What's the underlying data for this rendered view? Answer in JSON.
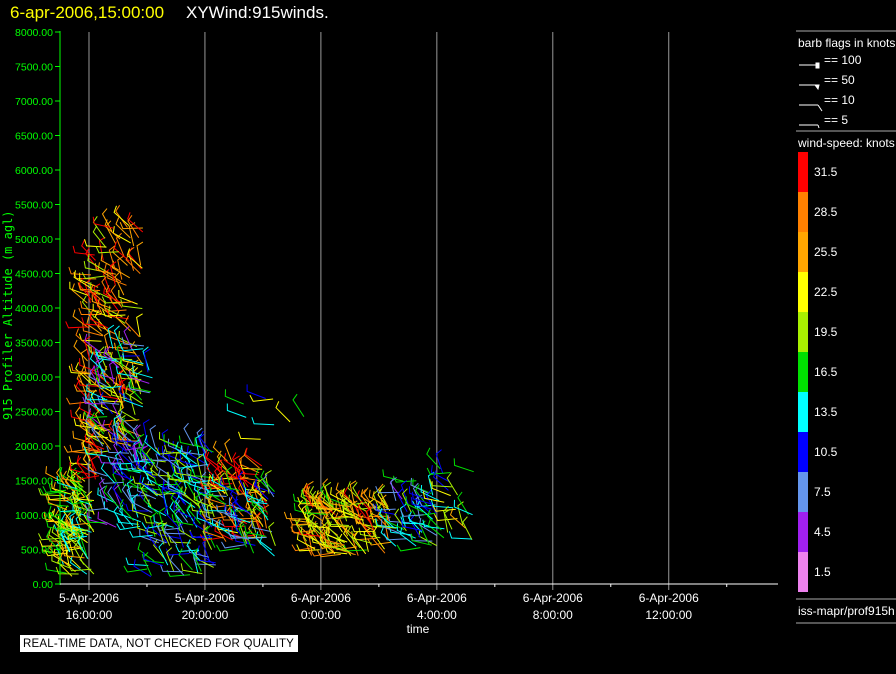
{
  "header": {
    "datetime": "6-apr-2006,15:00:00",
    "title": "XYWind:915winds."
  },
  "notice": "REAL-TIME DATA, NOT CHECKED FOR QUALITY",
  "legend": {
    "barb_title": "barb flags in knots",
    "barb_items": [
      "== 100",
      "== 50",
      "== 10",
      "== 5"
    ],
    "speed_title": "wind-speed: knots",
    "speed_labels": [
      "31.5",
      "28.5",
      "25.5",
      "22.5",
      "19.5",
      "16.5",
      "13.5",
      "10.5",
      "7.5",
      "4.5",
      "1.5"
    ],
    "speed_colors": [
      "#ff0000",
      "#ff8000",
      "#ffa500",
      "#ffff00",
      "#a8f000",
      "#00e000",
      "#00ffff",
      "#0000ff",
      "#6495ed",
      "#a020f0",
      "#ee82ee"
    ],
    "source": "iss-mapr/prof915h"
  },
  "chart_data": {
    "type": "scatter",
    "subtype": "wind-barb",
    "title": "XYWind:915winds.",
    "xlabel": "time",
    "ylabel": "915 Profiler Altitude (m agl)",
    "ylim": [
      0,
      8000
    ],
    "yticks": [
      "0.00",
      "500.00",
      "1000.00",
      "1500.00",
      "2000.00",
      "2500.00",
      "3000.00",
      "3500.00",
      "4000.00",
      "4500.00",
      "5000.00",
      "5500.00",
      "6000.00",
      "6500.00",
      "7000.00",
      "7500.00",
      "8000.00"
    ],
    "xlim_hours_from_5Apr1500": [
      0,
      24.7
    ],
    "xticks": [
      {
        "hour": 1,
        "date": "5-Apr-2006",
        "time": "16:00:00"
      },
      {
        "hour": 5,
        "date": "5-Apr-2006",
        "time": "20:00:00"
      },
      {
        "hour": 9,
        "date": "6-Apr-2006",
        "time": "0:00:00"
      },
      {
        "hour": 13,
        "date": "6-Apr-2006",
        "time": "4:00:00"
      },
      {
        "hour": 17,
        "date": "6-Apr-2006",
        "time": "8:00:00"
      },
      {
        "hour": 21,
        "date": "6-Apr-2006",
        "time": "12:00:00"
      }
    ],
    "grid": "vertical",
    "clusters": [
      {
        "t": [
          0.0,
          1.2
        ],
        "alt": [
          100,
          1500
        ],
        "speed": 20,
        "n": 110
      },
      {
        "t": [
          0.9,
          1.5
        ],
        "alt": [
          1500,
          4800
        ],
        "speed": 27,
        "n": 70
      },
      {
        "t": [
          1.5,
          2.9
        ],
        "alt": [
          1800,
          5300
        ],
        "speed": 25,
        "n": 130
      },
      {
        "t": [
          1.3,
          3.2
        ],
        "alt": [
          800,
          3500
        ],
        "speed": 10,
        "n": 110
      },
      {
        "t": [
          3.0,
          5.4
        ],
        "alt": [
          100,
          2000
        ],
        "speed": 14,
        "n": 160
      },
      {
        "t": [
          5.5,
          7.2
        ],
        "alt": [
          500,
          1800
        ],
        "speed": 27,
        "n": 70
      },
      {
        "t": [
          5.2,
          7.5
        ],
        "alt": [
          400,
          1400
        ],
        "speed": 13,
        "n": 60
      },
      {
        "t": [
          8.5,
          11.5
        ],
        "alt": [
          400,
          1200
        ],
        "speed": 24,
        "n": 150
      },
      {
        "t": [
          11.5,
          13.0
        ],
        "alt": [
          500,
          1500
        ],
        "speed": 12,
        "n": 50
      },
      {
        "t": [
          6.0,
          8.6
        ],
        "alt": [
          2000,
          2700
        ],
        "speed": 18,
        "n": 8
      },
      {
        "t": [
          13.0,
          14.3
        ],
        "alt": [
          600,
          1700
        ],
        "speed": 18,
        "n": 25
      }
    ]
  }
}
